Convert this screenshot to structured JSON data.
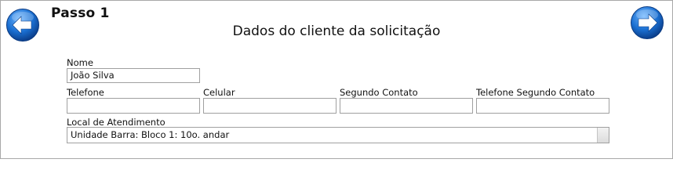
{
  "header": {
    "step_title": "Passo 1",
    "form_title": "Dados do cliente da solicitação"
  },
  "navigation": {
    "back_icon": "arrow-left-icon",
    "forward_icon": "arrow-right-icon",
    "accent_color": "#1a6fd1"
  },
  "fields": {
    "nome": {
      "label": "Nome",
      "value": "João Silva"
    },
    "telefone": {
      "label": "Telefone",
      "value": ""
    },
    "celular": {
      "label": "Celular",
      "value": ""
    },
    "segundo_contato": {
      "label": "Segundo Contato",
      "value": ""
    },
    "telefone_segundo_contato": {
      "label": "Telefone Segundo Contato",
      "value": ""
    },
    "local_atendimento": {
      "label": "Local de Atendimento",
      "selected": "Unidade Barra: Bloco 1: 10o. andar"
    }
  }
}
